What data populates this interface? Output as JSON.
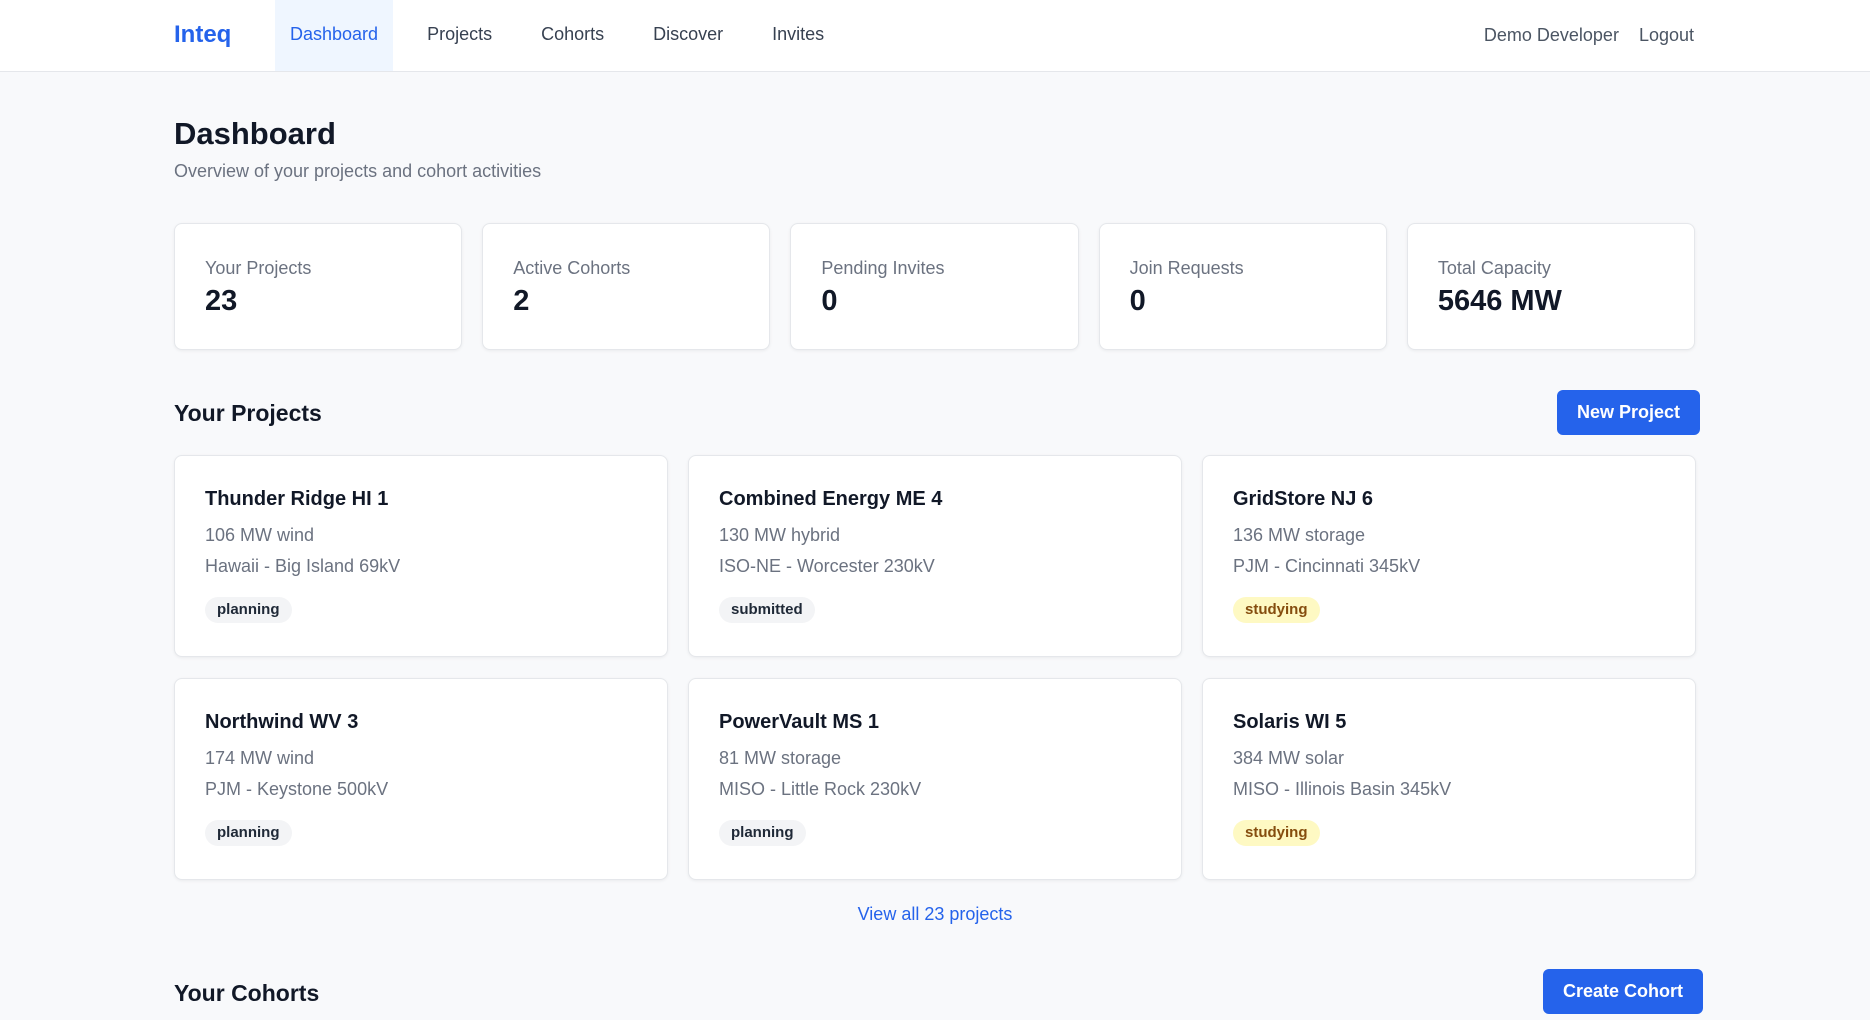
{
  "brand": "Inteq",
  "nav": [
    {
      "label": "Dashboard",
      "active": true
    },
    {
      "label": "Projects",
      "active": false
    },
    {
      "label": "Cohorts",
      "active": false
    },
    {
      "label": "Discover",
      "active": false
    },
    {
      "label": "Invites",
      "active": false
    }
  ],
  "user": {
    "name": "Demo Developer",
    "logout_label": "Logout"
  },
  "page": {
    "title": "Dashboard",
    "subtitle": "Overview of your projects and cohort activities"
  },
  "stats": [
    {
      "label": "Your Projects",
      "value": "23"
    },
    {
      "label": "Active Cohorts",
      "value": "2"
    },
    {
      "label": "Pending Invites",
      "value": "0"
    },
    {
      "label": "Join Requests",
      "value": "0"
    },
    {
      "label": "Total Capacity",
      "value": "5646 MW"
    }
  ],
  "projects_section": {
    "title": "Your Projects",
    "new_button": "New Project",
    "view_all": "View all 23 projects",
    "items": [
      {
        "name": "Thunder Ridge HI 1",
        "size": "106 MW wind",
        "location": "Hawaii - Big Island 69kV",
        "status": "planning"
      },
      {
        "name": "Combined Energy ME 4",
        "size": "130 MW hybrid",
        "location": "ISO-NE - Worcester 230kV",
        "status": "submitted"
      },
      {
        "name": "GridStore NJ 6",
        "size": "136 MW storage",
        "location": "PJM - Cincinnati 345kV",
        "status": "studying"
      },
      {
        "name": "Northwind WV 3",
        "size": "174 MW wind",
        "location": "PJM - Keystone 500kV",
        "status": "planning"
      },
      {
        "name": "PowerVault MS 1",
        "size": "81 MW storage",
        "location": "MISO - Little Rock 230kV",
        "status": "planning"
      },
      {
        "name": "Solaris WI 5",
        "size": "384 MW solar",
        "location": "MISO - Illinois Basin 345kV",
        "status": "studying"
      }
    ]
  },
  "cohorts_section": {
    "title": "Your Cohorts",
    "create_button": "Create Cohort"
  },
  "status_colors": {
    "planning": {
      "bg": "#f3f4f6",
      "fg": "#1f2937"
    },
    "submitted": {
      "bg": "#f3f4f6",
      "fg": "#1f2937"
    },
    "studying": {
      "bg": "#fef9c3",
      "fg": "#854d0e"
    }
  },
  "colors": {
    "accent": "#2563eb"
  }
}
